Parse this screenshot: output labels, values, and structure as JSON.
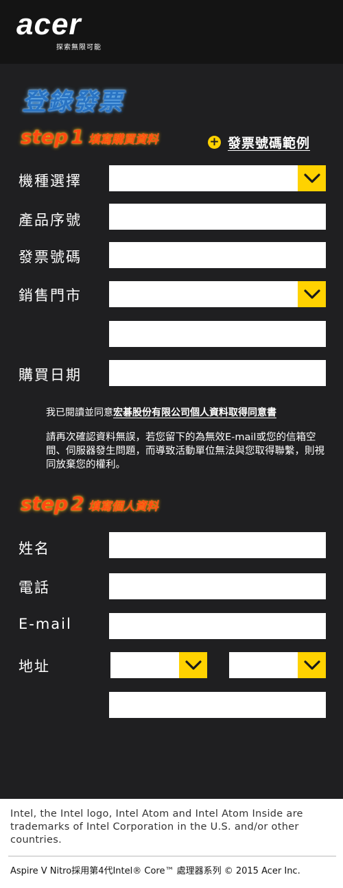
{
  "header": {
    "logo_text": "acer",
    "tagline": "探索無限可能"
  },
  "page_title": "登錄發票",
  "step1": {
    "step_word": "step",
    "step_number": "1",
    "heading": "填寫購買資料",
    "sample_link": "發票號碼範例",
    "fields": {
      "model_label": "機種選擇",
      "serial_label": "產品序號",
      "invoice_label": "發票號碼",
      "store_label": "銷售門市",
      "date_label": "購買日期"
    }
  },
  "consent": {
    "prefix": "我已閱讀並同意",
    "link": "宏碁股份有限公司個人資料取得同意書"
  },
  "notice": "請再次確認資料無誤，若您留下的為無效E-mail或您的信箱空間、伺服器發生問題，而導致活動單位無法與您取得聯繫，則視同放棄您的權利。",
  "step2": {
    "step_word": "step",
    "step_number": "2",
    "heading": "填寫個人資料",
    "fields": {
      "name_label": "姓名",
      "phone_label": "電話",
      "email_label": "E-mail",
      "address_label": "地址"
    }
  },
  "footer": {
    "legal": "Intel, the Intel logo, Intel Atom and Intel Atom Inside are trademarks of Intel Corporation in the U.S. and/or other countries.",
    "copyright": "Aspire V Nitro採用第4代Intel® Core™ 處理器系列  © 2015 Acer Inc."
  },
  "colors": {
    "accent_yellow": "#ffd200",
    "step_orange": "#ff4a12",
    "title_blue": "#2a74c4",
    "background": "#1f1f21"
  }
}
